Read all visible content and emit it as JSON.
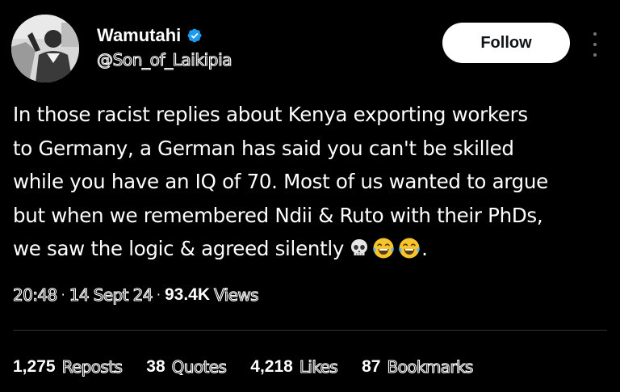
{
  "author": {
    "display_name": "Wamutahi",
    "handle": "@Son_of_Laikipia",
    "verified": true,
    "verified_color": "#1d9bf0"
  },
  "follow_label": "Follow",
  "tweet": {
    "lines": [
      "In those racist replies about Kenya exporting workers",
      "to Germany, a German has said you can't be skilled",
      "while you have an IQ of 70. Most of us wanted to argue",
      "but when we remembered Ndii & Ruto with their PhDs,",
      "we saw the logic & agreed silently"
    ],
    "emojis": [
      "skull",
      "face-with-tears-of-joy",
      "face-with-tears-of-joy"
    ],
    "trailing_text": "."
  },
  "meta": {
    "time": "20:48",
    "date": "14 Sept 24",
    "views_count": "93.4K",
    "views_label": "Views"
  },
  "stats": [
    {
      "count": "1,275",
      "label": "Reposts"
    },
    {
      "count": "38",
      "label": "Quotes"
    },
    {
      "count": "4,218",
      "label": "Likes"
    },
    {
      "count": "87",
      "label": "Bookmarks"
    }
  ]
}
